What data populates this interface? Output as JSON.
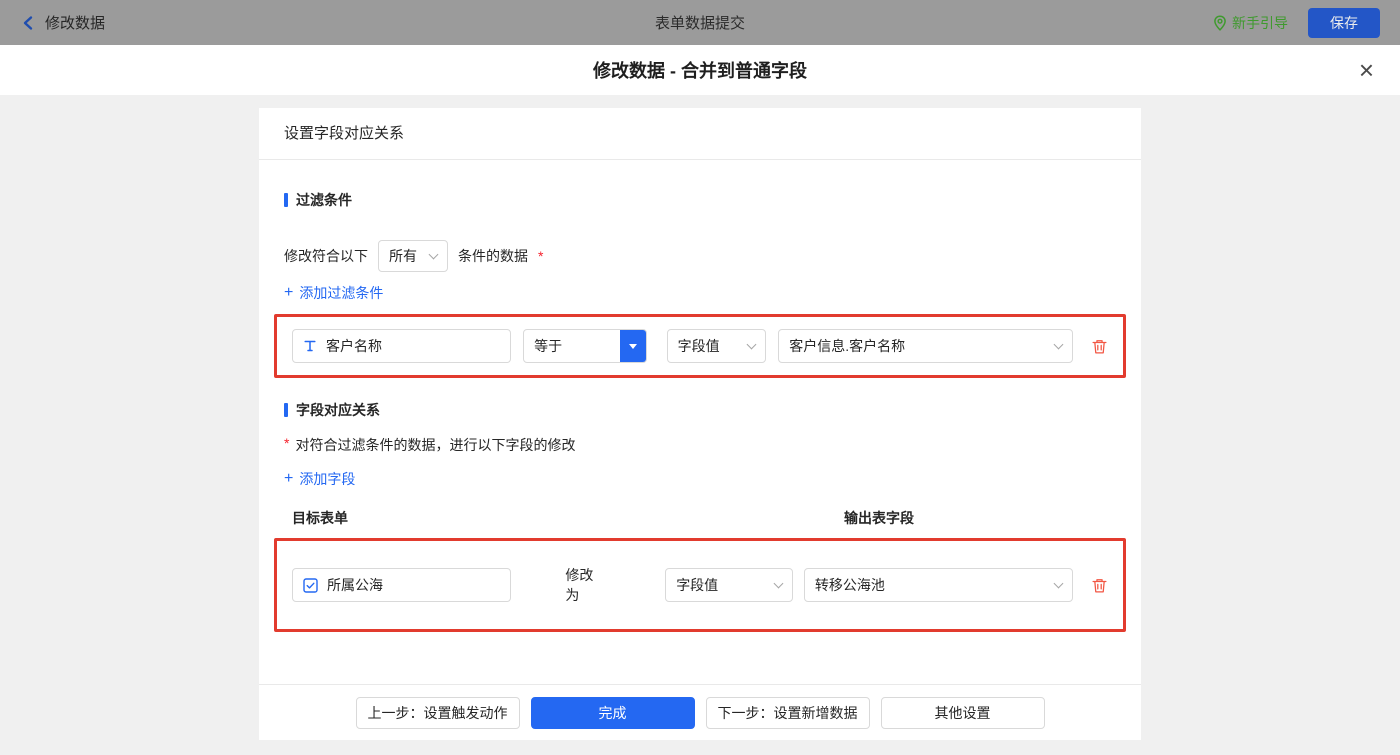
{
  "topbar": {
    "back_label": "修改数据",
    "title": "表单数据提交",
    "guide_label": "新手引导",
    "save_label": "保存"
  },
  "modal": {
    "title": "修改数据 - 合并到普通字段",
    "close_icon": "×"
  },
  "panel": {
    "header": "设置字段对应关系"
  },
  "filter": {
    "section_title": "过滤条件",
    "match_prefix": "修改符合以下",
    "match_value": "所有",
    "match_suffix": "条件的数据",
    "required_mark": "*",
    "plus": "+",
    "add_label": "添加过滤条件",
    "row": {
      "field_label": "客户名称",
      "operator": "等于",
      "value_type": "字段值",
      "value": "客户信息.客户名称"
    }
  },
  "mapping": {
    "section_title": "字段对应关系",
    "required_mark": "*",
    "description": "对符合过滤条件的数据，进行以下字段的修改",
    "plus": "+",
    "add_label": "添加字段",
    "col_target": "目标表单",
    "col_output": "输出表字段",
    "row": {
      "field_label": "所属公海",
      "action_label": "修改为",
      "value_type": "字段值",
      "value": "转移公海池"
    }
  },
  "footer": {
    "prev_label": "上一步：设置触发动作",
    "done_label": "完成",
    "next_label": "下一步：设置新增数据",
    "other_label": "其他设置"
  },
  "colors": {
    "accent": "#2468f2",
    "annotation": "#e23b2e",
    "danger": "#f25643",
    "guide_green": "#3f9a2e",
    "topbar_bg": "#9b9b9b"
  }
}
